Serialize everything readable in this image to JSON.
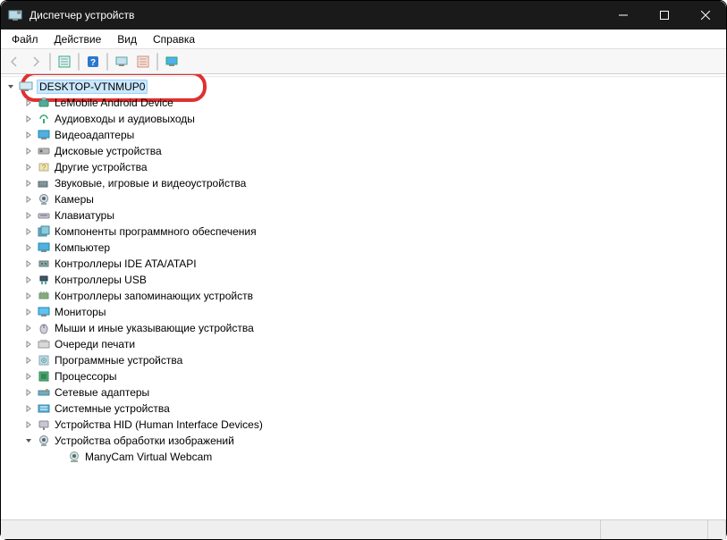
{
  "window": {
    "title": "Диспетчер устройств"
  },
  "menu": {
    "file": "Файл",
    "action": "Действие",
    "view": "Вид",
    "help": "Справка"
  },
  "root": {
    "label": "DESKTOP-VTNMUP0"
  },
  "categories": [
    {
      "label": "LeMobile Android Device"
    },
    {
      "label": "Аудиовходы и аудиовыходы"
    },
    {
      "label": "Видеоадаптеры"
    },
    {
      "label": "Дисковые устройства"
    },
    {
      "label": "Другие устройства"
    },
    {
      "label": "Звуковые, игровые и видеоустройства"
    },
    {
      "label": "Камеры"
    },
    {
      "label": "Клавиатуры"
    },
    {
      "label": "Компоненты программного обеспечения"
    },
    {
      "label": "Компьютер"
    },
    {
      "label": "Контроллеры IDE ATA/ATAPI"
    },
    {
      "label": "Контроллеры USB"
    },
    {
      "label": "Контроллеры запоминающих устройств"
    },
    {
      "label": "Мониторы"
    },
    {
      "label": "Мыши и иные указывающие устройства"
    },
    {
      "label": "Очереди печати"
    },
    {
      "label": "Программные устройства"
    },
    {
      "label": "Процессоры"
    },
    {
      "label": "Сетевые адаптеры"
    },
    {
      "label": "Системные устройства"
    },
    {
      "label": "Устройства HID (Human Interface Devices)"
    },
    {
      "label": "Устройства обработки изображений"
    }
  ],
  "expanded_child": {
    "label": "ManyCam Virtual Webcam"
  }
}
